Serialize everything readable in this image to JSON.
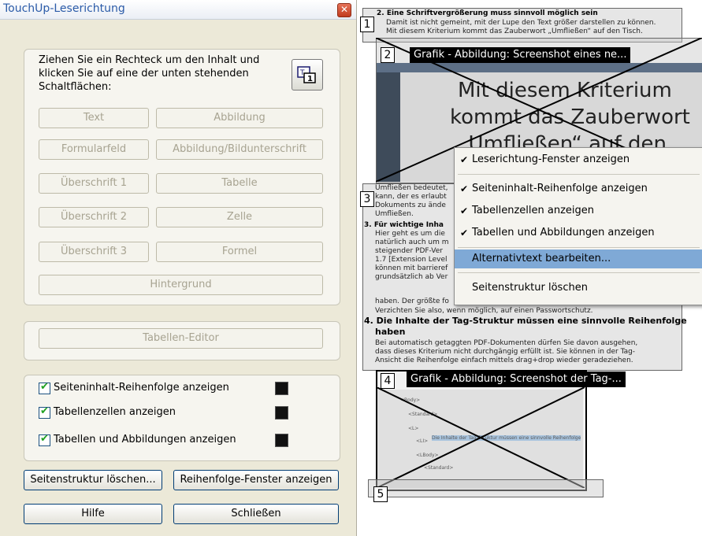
{
  "dialog": {
    "title": "TouchUp-Leserichtung",
    "close_glyph": "✕",
    "instructions": "Ziehen Sie ein Rechteck um den Inhalt und klicken Sie auf eine der unten stehenden Schaltflächen:",
    "buttons": {
      "text": "Text",
      "figure": "Abbildung",
      "form_field": "Formularfeld",
      "figure_caption": "Abbildung/Bildunterschrift",
      "heading1": "Überschrift 1",
      "table": "Tabelle",
      "heading2": "Überschrift 2",
      "cell": "Zelle",
      "heading3": "Überschrift 3",
      "formula": "Formel",
      "background": "Hintergrund",
      "table_editor": "Tabellen-Editor"
    },
    "checkboxes": {
      "page_order": "Seiteninhalt-Reihenfolge anzeigen",
      "table_cells": "Tabellenzellen anzeigen",
      "tables_figures": "Tabellen und Abbildungen anzeigen",
      "check_glyph": "✔"
    },
    "footer": {
      "clear_structure": "Seitenstruktur löschen...",
      "order_window": "Reihenfolge-Fenster anzeigen",
      "help": "Hilfe",
      "close": "Schließen"
    }
  },
  "document": {
    "badges": [
      "1",
      "2",
      "3",
      "4",
      "5"
    ],
    "heading_line": "2. Eine Schriftvergrößerung muss sinnvoll möglich sein",
    "lines_top": [
      "Damit ist nicht gemeint, mit der Lupe den Text größer darstellen zu können.",
      "Mit diesem Kriterium kommt das Zauberwort „Umfließen“ auf den Tisch."
    ],
    "figure2_label": "Grafik - Abbildung: Screenshot eines ne...",
    "figure2_text": [
      "Mit diesem Kriterium",
      "kommt das Zauberwort",
      "„Umfließen“ auf den"
    ],
    "lines_block3": [
      "Umfließen bedeutet,",
      "kann, der es erlaubt",
      "Dokuments zu ände",
      "Umfließen.",
      "3.  Für wichtige Inha",
      "Hier geht es um die",
      "natürlich auch um m",
      "steigender PDF-Ver",
      "1.7 [Extension Level",
      "können mit barrieref",
      "grundsätzlich ab Ver",
      "haben. Der größte fo",
      "Verzichten Sie also, wenn möglich, auf einen Passwortschutz.",
      "4.  Die Inhalte der Tag-Struktur müssen eine sinnvolle Reihenfolge",
      "haben",
      "Bei automatisch getaggten PDF-Dokumenten dürfen Sie davon ausgehen,",
      "dass dieses Kriterium nicht durchgängig erfüllt ist. Sie können in der Tag-",
      "Ansicht die Reihenfolge einfach mittels drag+drop wieder geradeziehen."
    ],
    "figure4_label": "Grafik - Abbildung: Screenshot der Tag-...",
    "tag_tree": [
      "<Body>",
      "<Standard>",
      "<L>",
      "<LI>",
      "<LBody>",
      "<Standard>",
      "Die Inhalte der Tag-Struktur müssen eine sinnvolle Reihenfolge"
    ]
  },
  "context_menu": {
    "items": [
      {
        "label": "Leserichtung-Fenster anzeigen",
        "checked": "✔"
      },
      {
        "label": "Seiteninhalt-Reihenfolge anzeigen",
        "checked": "✔"
      },
      {
        "label": "Tabellenzellen anzeigen",
        "checked": "✔"
      },
      {
        "label": "Tabellen und Abbildungen anzeigen",
        "checked": "✔"
      },
      {
        "label": "Alternativtext bearbeiten...",
        "checked": ""
      },
      {
        "label": "Seitenstruktur löschen",
        "checked": ""
      }
    ]
  },
  "colors": {
    "dialog_bg": "#ece9d8",
    "title_text": "#2b5ba8",
    "menu_highlight": "#7fa9d6",
    "order_swatch": "#111111"
  }
}
